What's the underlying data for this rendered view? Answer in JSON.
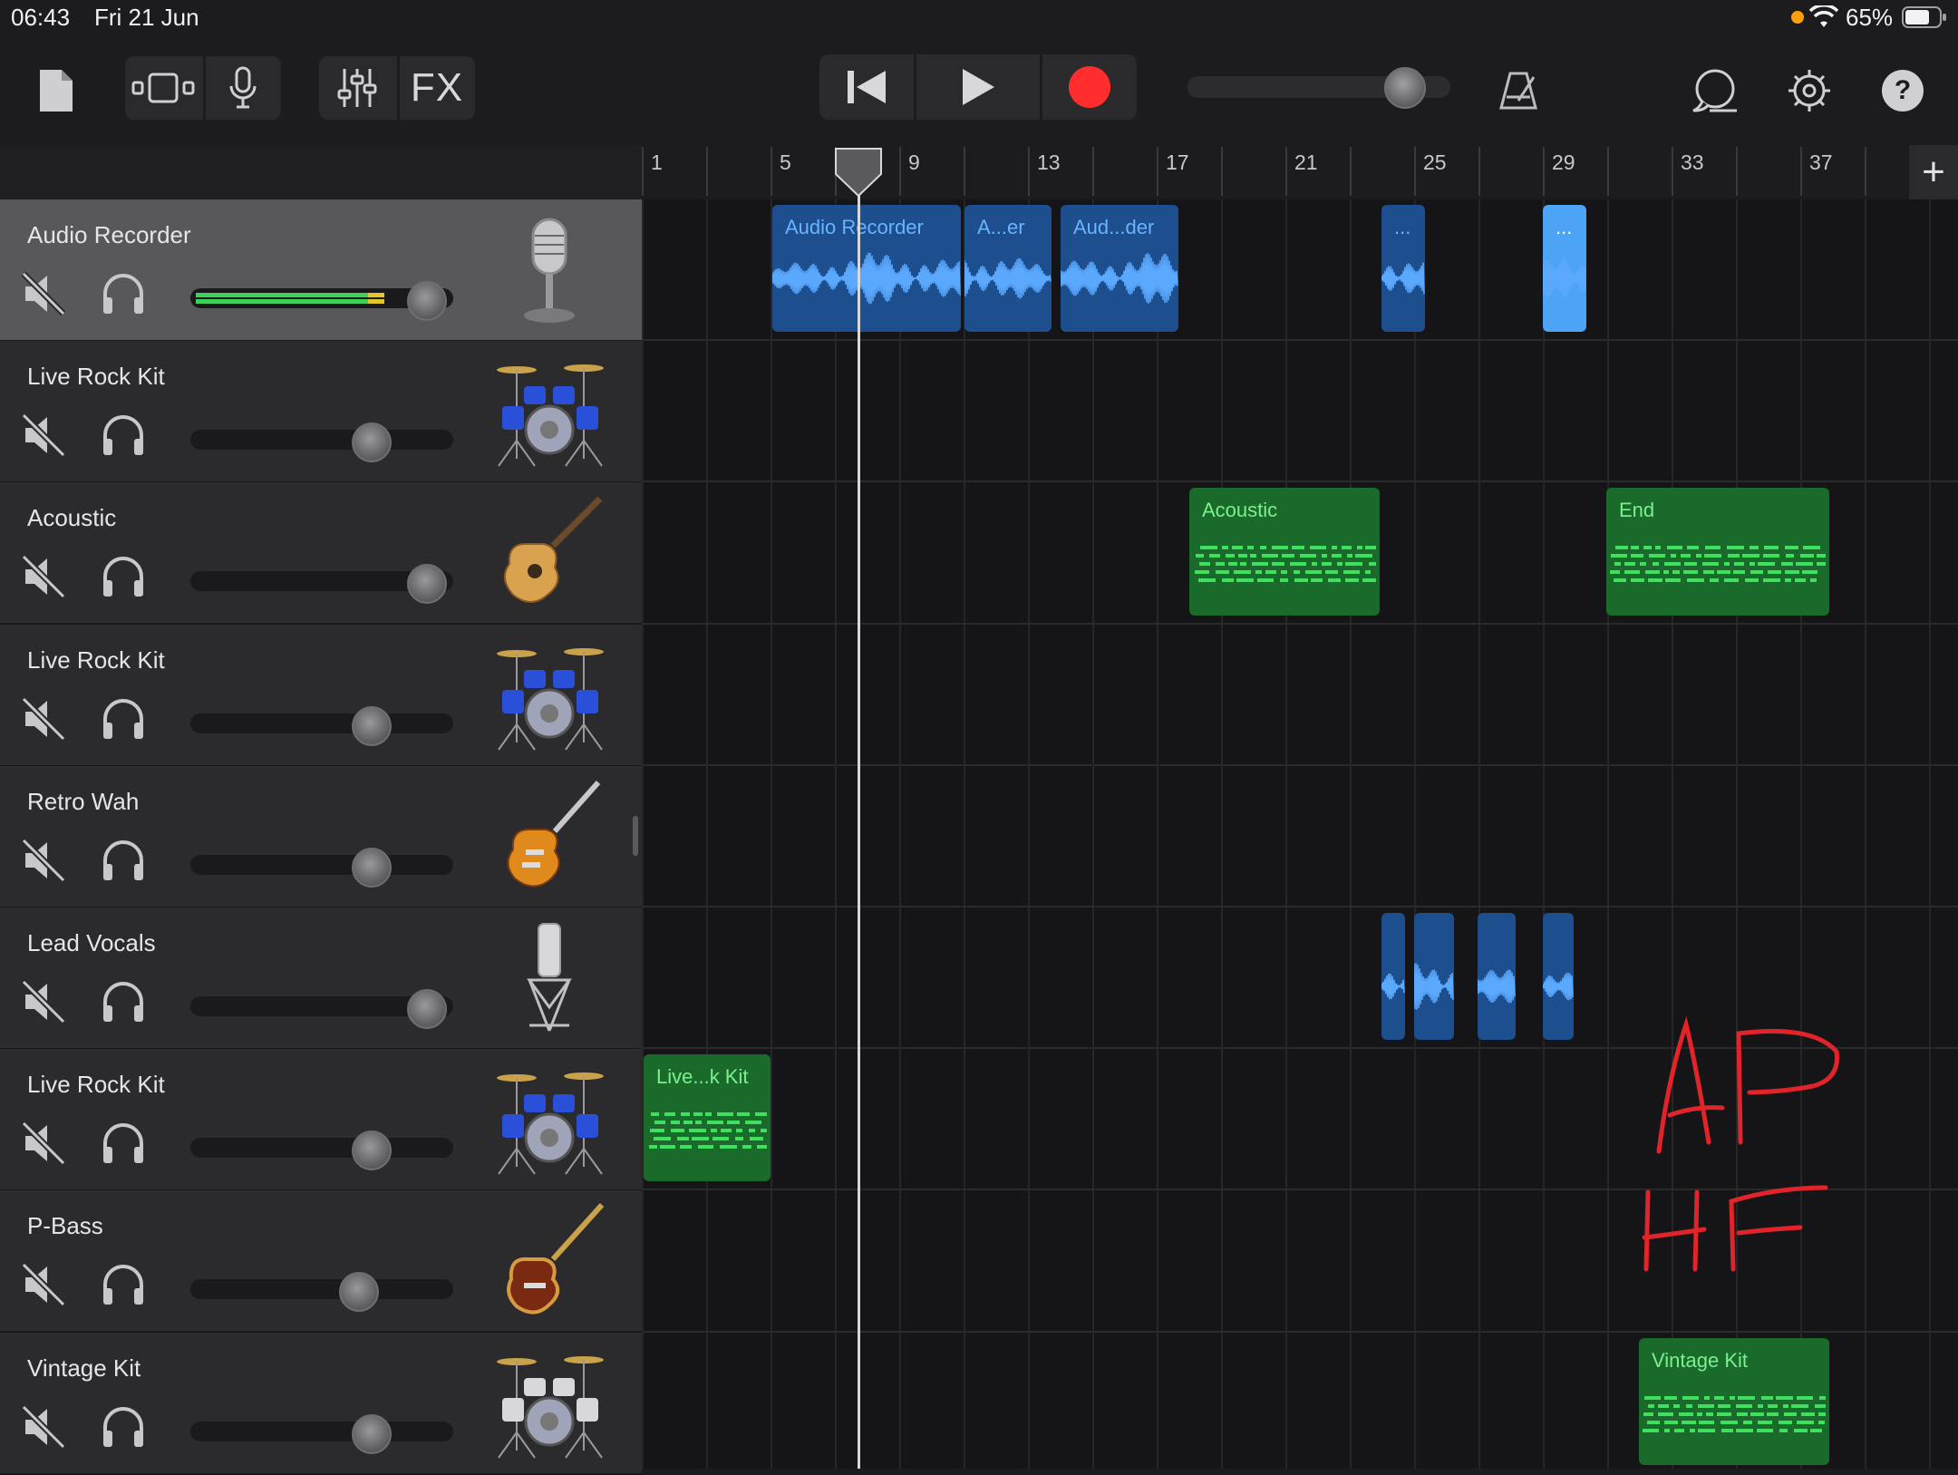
{
  "status_bar": {
    "time": "06:43",
    "date": "Fri 21 Jun",
    "battery": "65%"
  },
  "colors": {
    "audio_region": "#1d4e8e",
    "audio_region_selected": "#4da3f5",
    "midi_region": "#1a6b2b",
    "record": "#ff2d2d",
    "handwriting": "#e0242a"
  },
  "toolbar": {
    "icons": [
      "document-icon",
      "track-view-icon",
      "microphone-icon",
      "mixer-icon",
      "fx-icon",
      "rewind-icon",
      "play-icon",
      "record-icon",
      "metronome-icon",
      "loop-icon",
      "settings-icon",
      "help-icon"
    ],
    "fx_label": "FX",
    "master_volume": 0.88
  },
  "ruler": {
    "bars": [
      "1",
      "5",
      "9",
      "13",
      "17",
      "21",
      "25",
      "29",
      "33",
      "37"
    ],
    "add_label": "+"
  },
  "tracks": [
    {
      "name": "Audio Recorder",
      "volume": 0.9,
      "instrument": "microphone",
      "selected": true
    },
    {
      "name": "Live Rock Kit",
      "volume": 0.69,
      "instrument": "drum-kit"
    },
    {
      "name": "Acoustic",
      "volume": 0.9,
      "instrument": "acoustic-guitar"
    },
    {
      "name": "Live Rock Kit",
      "volume": 0.69,
      "instrument": "drum-kit"
    },
    {
      "name": "Retro Wah",
      "volume": 0.69,
      "instrument": "electric-guitar"
    },
    {
      "name": "Lead Vocals",
      "volume": 0.9,
      "instrument": "studio-microphone"
    },
    {
      "name": "Live Rock Kit",
      "volume": 0.69,
      "instrument": "drum-kit"
    },
    {
      "name": "P-Bass",
      "volume": 0.64,
      "instrument": "bass-guitar"
    },
    {
      "name": "Vintage Kit",
      "volume": 0.69,
      "instrument": "vintage-drum-kit"
    }
  ],
  "regions": [
    {
      "label": "Audio Recorder",
      "track": 1
    },
    {
      "label": "A...er",
      "track": 1
    },
    {
      "label": "Aud...der",
      "track": 1
    },
    {
      "label": "...",
      "track": 1
    },
    {
      "label": "...",
      "track": 1,
      "selected": true
    },
    {
      "label": "Acoustic",
      "track": 3
    },
    {
      "label": "End",
      "track": 3
    },
    {
      "label": "Live...k Kit",
      "track": 7
    },
    {
      "label": "Vintage Kit",
      "track": 9
    }
  ],
  "handwriting": "AP HF"
}
